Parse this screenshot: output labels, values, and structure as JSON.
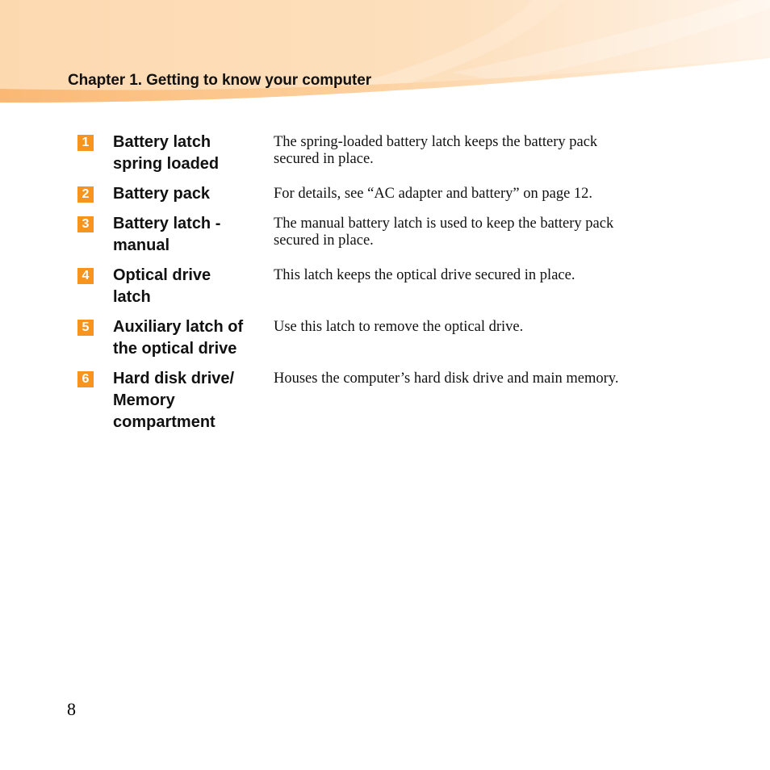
{
  "header": {
    "chapter_title": "Chapter 1. Getting to know your computer",
    "accent_color": "#f7941d"
  },
  "items": [
    {
      "number": "1",
      "term_lines": [
        "Battery latch",
        "spring loaded"
      ],
      "description_lines": [
        "The spring-loaded battery latch keeps the battery pack",
        "secured in place."
      ]
    },
    {
      "number": "2",
      "term_lines": [
        "Battery pack"
      ],
      "description_lines": [
        "For details, see “AC adapter and battery” on page 12."
      ]
    },
    {
      "number": "3",
      "term_lines": [
        "Battery latch -",
        "manual"
      ],
      "description_lines": [
        "The manual battery latch is used to keep the battery pack",
        "secured in place."
      ]
    },
    {
      "number": "4",
      "term_lines": [
        "Optical drive",
        "latch"
      ],
      "description_lines": [
        "This latch keeps the optical drive secured in place."
      ]
    },
    {
      "number": "5",
      "term_lines": [
        "Auxiliary latch of",
        "the optical drive"
      ],
      "description_lines": [
        "Use this latch to remove the optical drive."
      ]
    },
    {
      "number": "6",
      "term_lines": [
        "Hard disk drive/",
        "Memory",
        "compartment"
      ],
      "description_lines": [
        "Houses the computer’s hard disk drive and main memory."
      ]
    }
  ],
  "footer": {
    "page_number": "8"
  }
}
